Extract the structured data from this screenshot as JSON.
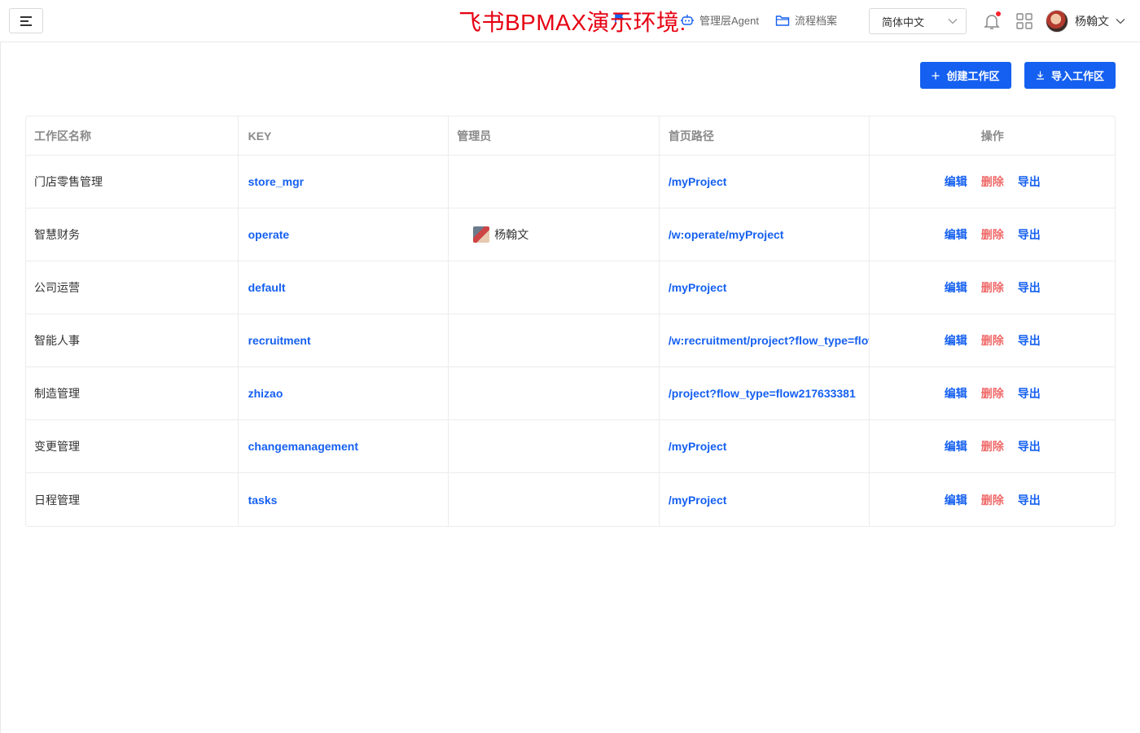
{
  "header": {
    "watermark": "飞书BPMAX演示环境.",
    "nav": [
      {
        "label": "",
        "icon": "flag-icon"
      },
      {
        "label": "管理层Agent",
        "icon": "agent-icon"
      },
      {
        "label": "流程档案",
        "icon": "folder-icon"
      }
    ],
    "language": "简体中文",
    "user_name": "杨翰文"
  },
  "toolbar": {
    "create_label": "创建工作区",
    "import_label": "导入工作区"
  },
  "table": {
    "headers": [
      "工作区名称",
      "KEY",
      "管理员",
      "首页路径",
      "操作"
    ],
    "rows": [
      {
        "name": "门店零售管理",
        "key": "store_mgr",
        "admin": "",
        "path": "/myProject"
      },
      {
        "name": "智慧财务",
        "key": "operate",
        "admin": "杨翰文",
        "path": "/w:operate/myProject"
      },
      {
        "name": "公司运营",
        "key": "default",
        "admin": "",
        "path": "/myProject"
      },
      {
        "name": "智能人事",
        "key": "recruitment",
        "admin": "",
        "path": "/w:recruitment/project?flow_type=flow"
      },
      {
        "name": "制造管理",
        "key": "zhizao",
        "admin": "",
        "path": "/project?flow_type=flow217633381"
      },
      {
        "name": "变更管理",
        "key": "changemanagement",
        "admin": "",
        "path": "/myProject"
      },
      {
        "name": "日程管理",
        "key": "tasks",
        "admin": "",
        "path": "/myProject"
      }
    ],
    "actions": {
      "edit": "编辑",
      "delete": "删除",
      "export": "导出"
    }
  },
  "colors": {
    "primary": "#1560f0",
    "danger": "#f06a6a",
    "watermark": "#e60012"
  }
}
